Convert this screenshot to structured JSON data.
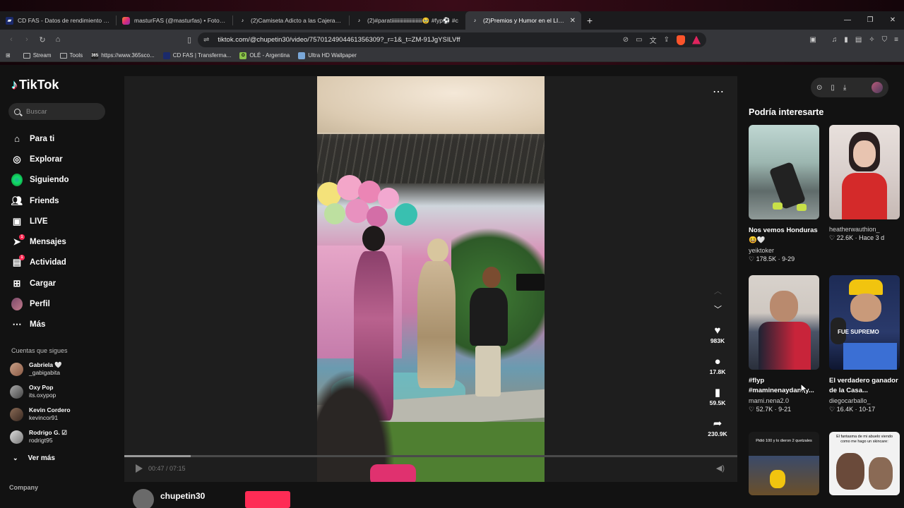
{
  "browser": {
    "tabs": [
      {
        "title": "CD FAS - Datos de rendimiento del e",
        "icon": "fas-icon",
        "active": false
      },
      {
        "title": "masturFAS (@masturfas) • Fotos y vi",
        "icon": "instagram-icon",
        "active": false
      },
      {
        "title": "(2)Camiseta Adicto a las Cajeras: Con",
        "icon": "tiktok-icon",
        "active": false
      },
      {
        "title": "(2)#paratiiiiiiiiiiiiiiiiiiiiiii🥹 #fyp⚽ #c",
        "icon": "tiktok-icon",
        "active": false
      },
      {
        "title": "(2)Premios y Humor en el LIVEFa",
        "icon": "tiktok-icon",
        "active": true
      }
    ],
    "url": "tiktok.com/@chupetin30/video/7570124904461356309?_r=1&_t=ZM-91JgYSILVff",
    "bookmarks": [
      "Stream",
      "Tools",
      "https://www.365sco...",
      "CD FAS | Transferma...",
      "OLÉ - Argentina",
      "Ultra HD Wallpaper"
    ]
  },
  "sidebar": {
    "logo": "TikTok",
    "search_placeholder": "Buscar",
    "menu": [
      {
        "label": "Para ti",
        "icon": "home-icon"
      },
      {
        "label": "Explorar",
        "icon": "compass-icon"
      },
      {
        "label": "Siguiendo",
        "icon": "following-icon"
      },
      {
        "label": "Friends",
        "icon": "friends-icon"
      },
      {
        "label": "LIVE",
        "icon": "live-icon"
      },
      {
        "label": "Mensajes",
        "icon": "messages-icon",
        "badge": "1"
      },
      {
        "label": "Actividad",
        "icon": "activity-icon",
        "badge": "1"
      },
      {
        "label": "Cargar",
        "icon": "upload-icon"
      },
      {
        "label": "Perfil",
        "icon": "profile-icon"
      },
      {
        "label": "Más",
        "icon": "more-icon"
      }
    ],
    "following_header": "Cuentas que sigues",
    "following": [
      {
        "name": "Gabriela 🤍",
        "user": "_gabigabita"
      },
      {
        "name": "Oxy Pop",
        "user": "its.oxypop"
      },
      {
        "name": "Kevin Cordero",
        "user": "kevincor91"
      },
      {
        "name": "Rodrigo G. ☑",
        "user": "rodrigt95"
      }
    ],
    "see_more": "Ver más",
    "company": "Company"
  },
  "video": {
    "time": "00:47 / 07:15",
    "progress": 0.108,
    "likes": "983K",
    "comments": "17.8K",
    "saves": "59.5K",
    "shares": "230.9K",
    "author": "chupetin30"
  },
  "recommendations": {
    "title": "Podría interesarte",
    "cards": [
      {
        "title": "Nos vemos Honduras 😆🤍",
        "user": "yeiktoker",
        "meta": "♡ 178.5K · 9-29"
      },
      {
        "title": "",
        "user": "heatherwauthion_",
        "meta": "♡ 22.6K · Hace 3 d"
      },
      {
        "title": "#flyp #maminenaydanny...",
        "user": "mami.nena2.0",
        "meta": "♡ 52.7K · 9-21"
      },
      {
        "title": "El verdadero ganador de la Casa...",
        "user": "diegocarballo_",
        "meta": "♡ 16.4K · 10-17"
      }
    ],
    "thumb_caption_5": "Pidió 100 y lo dieron 2 quetzales",
    "thumb_caption_6": "El fantasma de mi abuelo viendo como me hago un skincare:",
    "thumb_text_4": "FUE SUPREMO"
  },
  "colors": {
    "accent": "#fe2c55",
    "bg": "#121212"
  }
}
